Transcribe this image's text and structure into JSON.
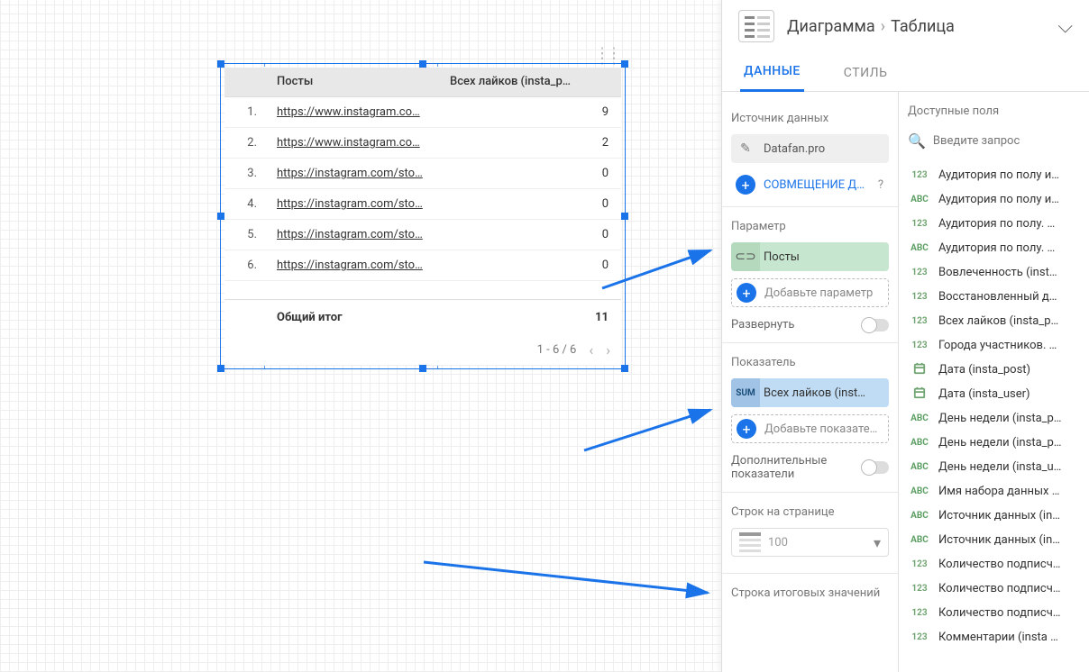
{
  "breadcrumb": {
    "chart": "Диаграмма",
    "table": "Таблица"
  },
  "tabs": {
    "data": "ДАННЫЕ",
    "style": "СТИЛЬ"
  },
  "widget": {
    "col_posts": "Посты",
    "col_likes": "Всех лайков (insta_p…",
    "rows": [
      {
        "n": "1.",
        "url": "https://www.instagram.co…",
        "v": "9"
      },
      {
        "n": "2.",
        "url": "https://www.instagram.co…",
        "v": "2"
      },
      {
        "n": "3.",
        "url": "https://instagram.com/sto…",
        "v": "0"
      },
      {
        "n": "4.",
        "url": "https://instagram.com/sto…",
        "v": "0"
      },
      {
        "n": "5.",
        "url": "https://instagram.com/sto…",
        "v": "0"
      },
      {
        "n": "6.",
        "url": "https://instagram.com/sto…",
        "v": "0"
      }
    ],
    "total_label": "Общий итог",
    "total_value": "11",
    "pager": "1 - 6 / 6"
  },
  "prop": {
    "source_h": "Источник данных",
    "source_v": "Datafan.pro",
    "combine": "СОВМЕЩЕНИЕ ДАНН",
    "dim_h": "Параметр",
    "dim_v": "Посты",
    "dim_add": "Добавьте параметр",
    "expand": "Развернуть",
    "met_h": "Показатель",
    "met_tag": "SUM",
    "met_v": "Всех лайков (inst…",
    "met_add": "Добавьте показатель",
    "optmet": "Дополнительные показатели",
    "rows_h": "Строк на странице",
    "rows_v": "100",
    "totals_h": "Строка итоговых значений"
  },
  "fields": {
    "header": "Доступные поля",
    "search_ph": "Введите запрос",
    "list": [
      {
        "t": "num",
        "n": "Аудитория по полу и…"
      },
      {
        "t": "abc",
        "n": "Аудитория по полу и…"
      },
      {
        "t": "num",
        "n": "Аудитория по полу. …"
      },
      {
        "t": "abc",
        "n": "Аудитория по полу. …"
      },
      {
        "t": "num",
        "n": "Вовлеченность (inst…"
      },
      {
        "t": "num",
        "n": "Восстановленный д…"
      },
      {
        "t": "num",
        "n": "Всех лайков (insta_p…"
      },
      {
        "t": "num",
        "n": "Города участников. …"
      },
      {
        "t": "cal",
        "n": "Дата (insta_post)"
      },
      {
        "t": "cal",
        "n": "Дата (insta_user)"
      },
      {
        "t": "abc",
        "n": "День недели (insta_p…"
      },
      {
        "t": "abc",
        "n": "День недели (insta_p…"
      },
      {
        "t": "abc",
        "n": "День недели (insta_u…"
      },
      {
        "t": "abc",
        "n": "Имя набора данных …"
      },
      {
        "t": "abc",
        "n": "Источник данных (in…"
      },
      {
        "t": "abc",
        "n": "Источник данных (in…"
      },
      {
        "t": "num",
        "n": "Количество подписч…"
      },
      {
        "t": "num",
        "n": "Количество подписч…"
      },
      {
        "t": "num",
        "n": "Количество подписч…"
      },
      {
        "t": "num",
        "n": "Комментарии (insta …"
      }
    ]
  }
}
